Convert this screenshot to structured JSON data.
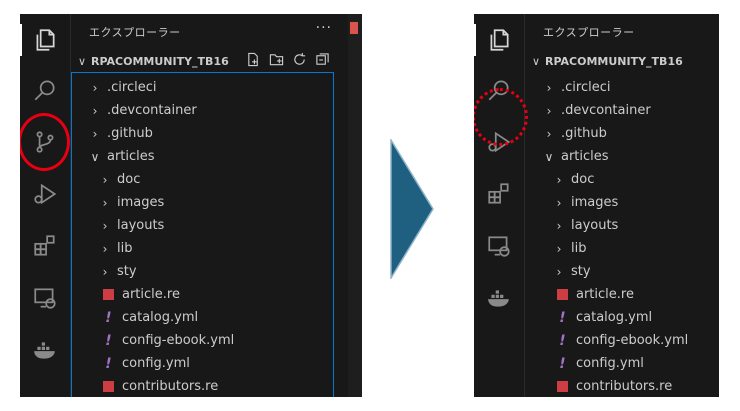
{
  "explorer": {
    "title": "エクスプローラー",
    "more_actions": "···",
    "workspace_chevron": "∨",
    "workspace_name": "RPACOMMUNITY_TB16",
    "header_actions": [
      "new-file-icon",
      "new-folder-icon",
      "refresh-icon",
      "collapse-all-icon"
    ]
  },
  "activity_bar": [
    "explorer-icon",
    "search-icon",
    "source-control-icon",
    "run-debug-icon",
    "extensions-icon",
    "remote-explorer-icon",
    "docker-icon"
  ],
  "before_tree": [
    {
      "label": ".circleci",
      "kind": "folder",
      "expanded": false,
      "indent": 1
    },
    {
      "label": ".devcontainer",
      "kind": "folder",
      "expanded": false,
      "indent": 1
    },
    {
      "label": ".github",
      "kind": "folder",
      "expanded": false,
      "indent": 1
    },
    {
      "label": "articles",
      "kind": "folder",
      "expanded": true,
      "indent": 1
    },
    {
      "label": "doc",
      "kind": "folder",
      "expanded": false,
      "indent": 2
    },
    {
      "label": "images",
      "kind": "folder",
      "expanded": false,
      "indent": 2
    },
    {
      "label": "layouts",
      "kind": "folder",
      "expanded": false,
      "indent": 2
    },
    {
      "label": "lib",
      "kind": "folder",
      "expanded": false,
      "indent": 2
    },
    {
      "label": "sty",
      "kind": "folder",
      "expanded": false,
      "indent": 2
    },
    {
      "label": "article.re",
      "kind": "re",
      "indent": 2
    },
    {
      "label": "catalog.yml",
      "kind": "yml",
      "indent": 2
    },
    {
      "label": "config-ebook.yml",
      "kind": "yml",
      "indent": 2
    },
    {
      "label": "config.yml",
      "kind": "yml",
      "indent": 2
    },
    {
      "label": "contributors.re",
      "kind": "re",
      "indent": 2
    }
  ],
  "after_tree": [
    {
      "label": ".circleci",
      "kind": "folder",
      "expanded": false,
      "indent": 1
    },
    {
      "label": ".devcontainer",
      "kind": "folder",
      "expanded": false,
      "indent": 1
    },
    {
      "label": ".github",
      "kind": "folder",
      "expanded": false,
      "indent": 1
    },
    {
      "label": "articles",
      "kind": "folder",
      "expanded": true,
      "indent": 1
    },
    {
      "label": "doc",
      "kind": "folder",
      "expanded": false,
      "indent": 2
    },
    {
      "label": "images",
      "kind": "folder",
      "expanded": false,
      "indent": 2
    },
    {
      "label": "layouts",
      "kind": "folder",
      "expanded": false,
      "indent": 2
    },
    {
      "label": "lib",
      "kind": "folder",
      "expanded": false,
      "indent": 2
    },
    {
      "label": "sty",
      "kind": "folder",
      "expanded": false,
      "indent": 2
    },
    {
      "label": "article.re",
      "kind": "re",
      "indent": 2
    },
    {
      "label": "catalog.yml",
      "kind": "yml",
      "indent": 2
    },
    {
      "label": "config-ebook.yml",
      "kind": "yml",
      "indent": 2
    },
    {
      "label": "config.yml",
      "kind": "yml",
      "indent": 2
    },
    {
      "label": "contributors.re",
      "kind": "re",
      "indent": 2
    }
  ],
  "colors": {
    "annotation_red": "#e60012",
    "arrow_blue": "#1f5f80",
    "focus_border": "#0078d4",
    "re_icon": "#cc3e44",
    "yml_icon": "#a074c4"
  }
}
